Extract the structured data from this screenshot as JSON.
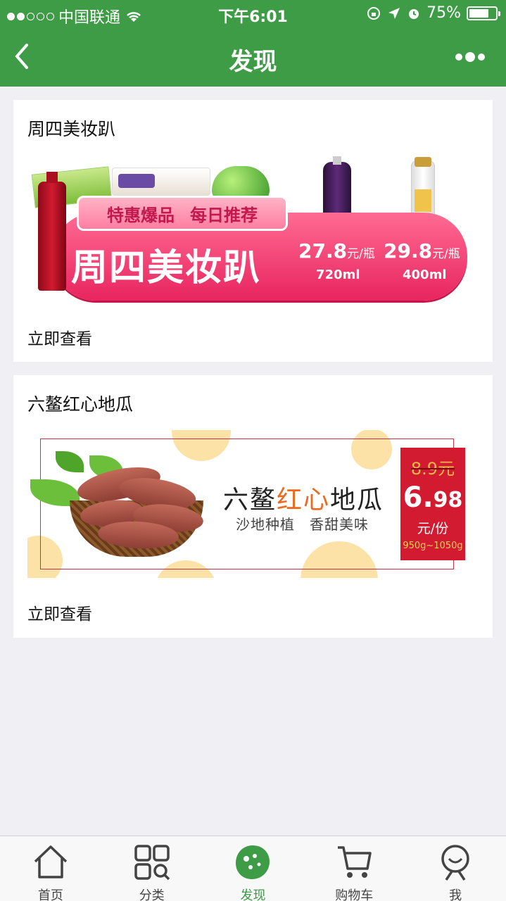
{
  "status_bar": {
    "carrier": "中国联通",
    "time": "下午6:01",
    "battery": "75%",
    "battery_level": 0.75
  },
  "nav": {
    "title": "发现"
  },
  "cards": [
    {
      "title": "周四美妆趴",
      "link": "立即查看",
      "banner": {
        "tag_left": "特惠爆品",
        "tag_right": "每日推荐",
        "headline": "周四美妆趴",
        "products": [
          {
            "price": "27.8",
            "unit": "元/瓶",
            "volume": "720ml"
          },
          {
            "price": "29.8",
            "unit": "元/瓶",
            "volume": "400ml"
          }
        ]
      }
    },
    {
      "title": "六鳌红心地瓜",
      "link": "立即查看",
      "banner": {
        "title_prefix": "六鳌",
        "title_highlight": "红心",
        "title_suffix": "地瓜",
        "subtitle": "沙地种植　香甜美味",
        "old_price": "8.9元",
        "new_price_int": "6.",
        "new_price_dec": "98",
        "unit": "元/份",
        "weight": "950g~1050g"
      }
    }
  ],
  "tab_bar": {
    "items": [
      {
        "label": "首页",
        "icon": "home-icon"
      },
      {
        "label": "分类",
        "icon": "category-icon"
      },
      {
        "label": "发现",
        "icon": "discover-icon",
        "active": true
      },
      {
        "label": "购物车",
        "icon": "cart-icon"
      },
      {
        "label": "我",
        "icon": "profile-icon"
      }
    ]
  },
  "colors": {
    "brand_green": "#3e9b46",
    "banner_pink": "#e8255f",
    "price_red": "#d21a30",
    "highlight_orange": "#ec6a1f"
  }
}
